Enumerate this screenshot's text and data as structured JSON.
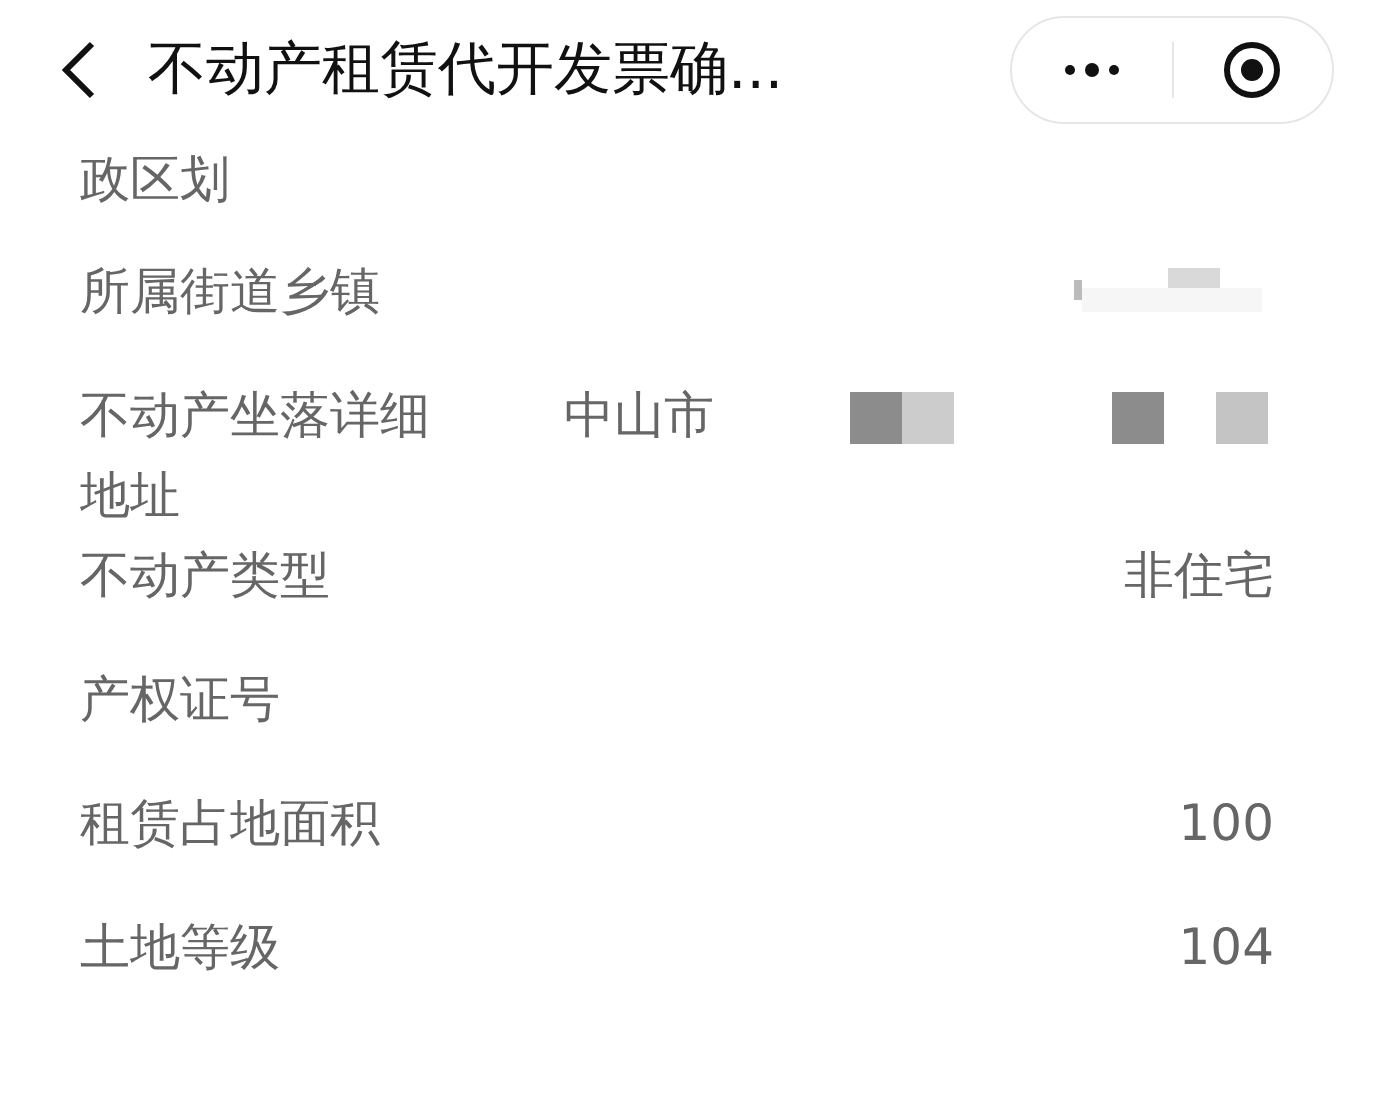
{
  "header": {
    "title": "不动产租赁代开发票确..."
  },
  "rows": [
    {
      "label": "政区划",
      "redacted": false
    },
    {
      "label": "所属街道乡镇",
      "redacted": true
    },
    {
      "label": "不动产坐落详细地址",
      "value": "中山市",
      "redacted": true
    },
    {
      "label": "不动产类型",
      "value": "非住宅",
      "redacted": false
    },
    {
      "label": "产权证号",
      "redacted": false
    },
    {
      "label": "租赁占地面积",
      "value": "100",
      "redacted": false
    },
    {
      "label": "土地等级",
      "value": "104",
      "redacted": false
    }
  ]
}
